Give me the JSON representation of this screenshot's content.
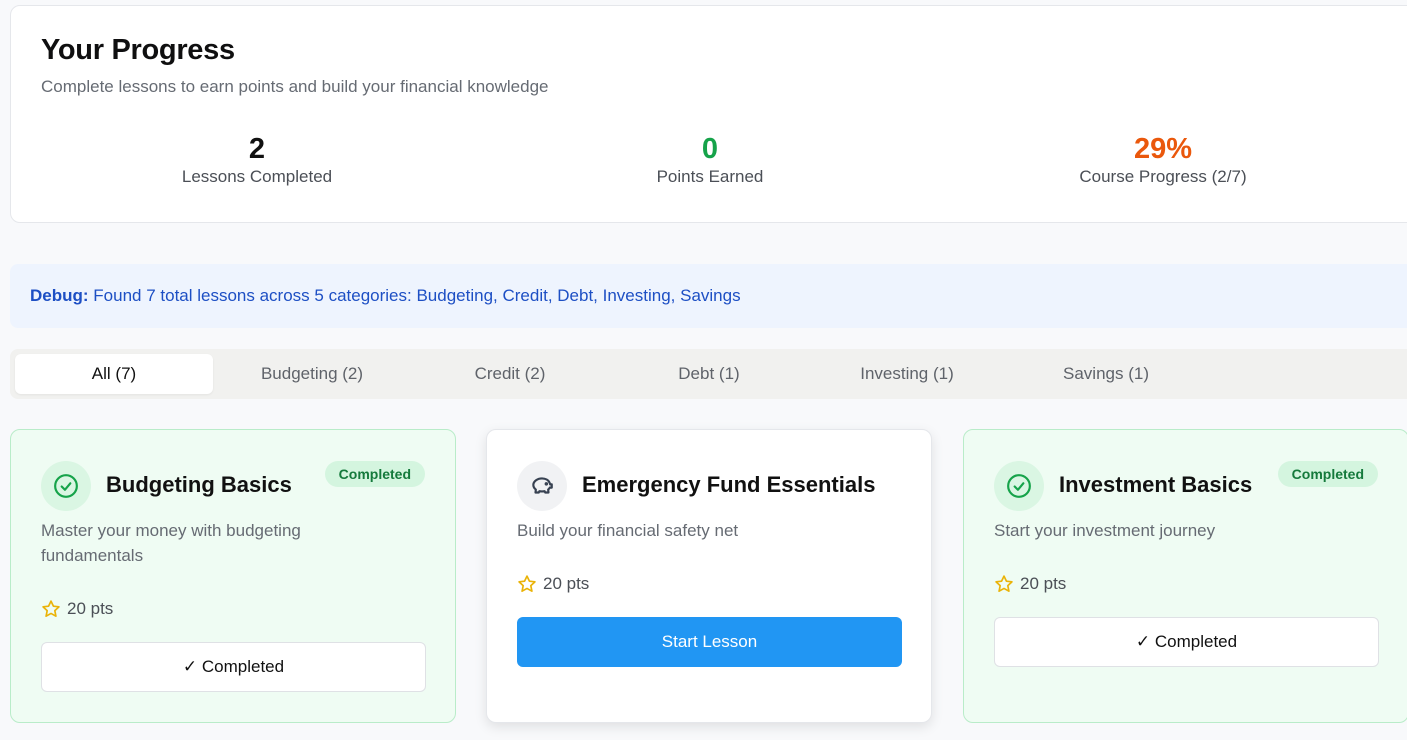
{
  "progress": {
    "title": "Your Progress",
    "subtitle": "Complete lessons to earn points and build your financial knowledge",
    "stats": [
      {
        "value": "2",
        "label": "Lessons Completed",
        "color": "#111111"
      },
      {
        "value": "0",
        "label": "Points Earned",
        "color": "#16a34a"
      },
      {
        "value": "29%",
        "label": "Course Progress (2/7)",
        "color": "#ea580c"
      }
    ]
  },
  "debug": {
    "label": "Debug:",
    "text": "Found 7 total lessons across 5 categories: Budgeting, Credit, Debt, Investing, Savings"
  },
  "tabs": [
    {
      "label": "All (7)",
      "active": true
    },
    {
      "label": "Budgeting (2)",
      "active": false
    },
    {
      "label": "Credit (2)",
      "active": false
    },
    {
      "label": "Debt (1)",
      "active": false
    },
    {
      "label": "Investing (1)",
      "active": false
    },
    {
      "label": "Savings (1)",
      "active": false
    }
  ],
  "lessons": [
    {
      "title": "Budgeting Basics",
      "description": "Master your money with budgeting fundamentals",
      "points": "20 pts",
      "badge": "Completed",
      "icon": "check-circle-icon",
      "action": "✓ Completed",
      "status": "completed"
    },
    {
      "title": "Emergency Fund Essentials",
      "description": "Build your financial safety net",
      "points": "20 pts",
      "icon": "piggy-bank-icon",
      "action": "Start Lesson",
      "status": "not-started"
    },
    {
      "title": "Investment Basics",
      "description": "Start your investment journey",
      "points": "20 pts",
      "badge": "Completed",
      "icon": "check-circle-icon",
      "action": "✓ Completed",
      "status": "completed"
    }
  ],
  "colors": {
    "accent": "#2196f3",
    "success": "#16a34a",
    "warning": "#ea580c",
    "star": "#eab308"
  }
}
